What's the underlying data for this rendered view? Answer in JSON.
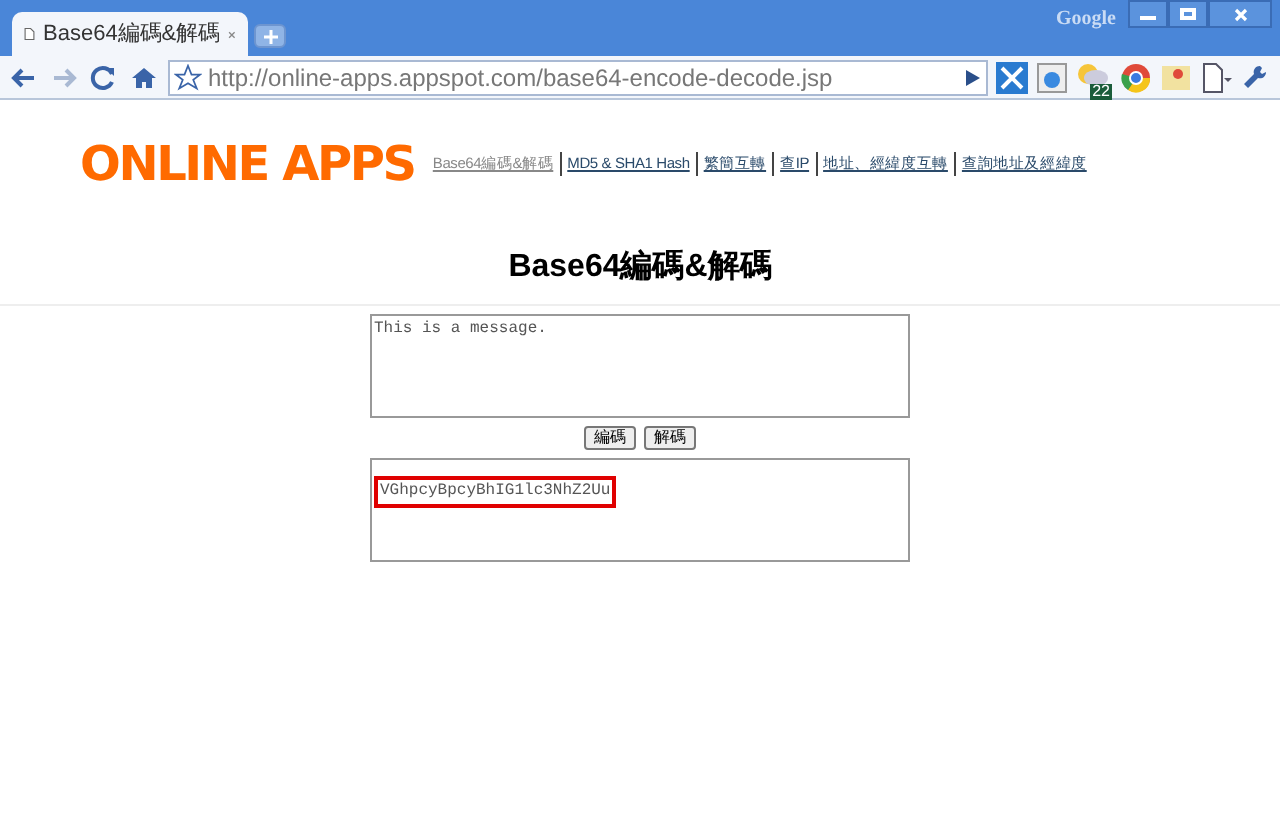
{
  "window": {
    "brand": "Google"
  },
  "tab": {
    "title": "Base64編碼&解碼"
  },
  "address_bar": {
    "url": "http://online-apps.appspot.com/base64-encode-decode.jsp"
  },
  "extensions": {
    "weather_badge": "22"
  },
  "logo": {
    "text": "ONLINE APPS"
  },
  "nav_links": [
    {
      "label": "Base64編碼&解碼",
      "visited": true
    },
    {
      "label": "MD5 & SHA1 Hash",
      "visited": false
    },
    {
      "label": "繁簡互轉",
      "visited": false
    },
    {
      "label": "查IP",
      "visited": false
    },
    {
      "label": "地址、經緯度互轉",
      "visited": false
    },
    {
      "label": "查詢地址及經緯度",
      "visited": false
    }
  ],
  "heading": "Base64編碼&解碼",
  "input": {
    "value": "This is a message."
  },
  "buttons": [
    "編碼",
    "解碼"
  ],
  "output": {
    "value": "VGhpcyBpcyBhIG1lc3NhZ2Uu",
    "highlighted": true
  }
}
